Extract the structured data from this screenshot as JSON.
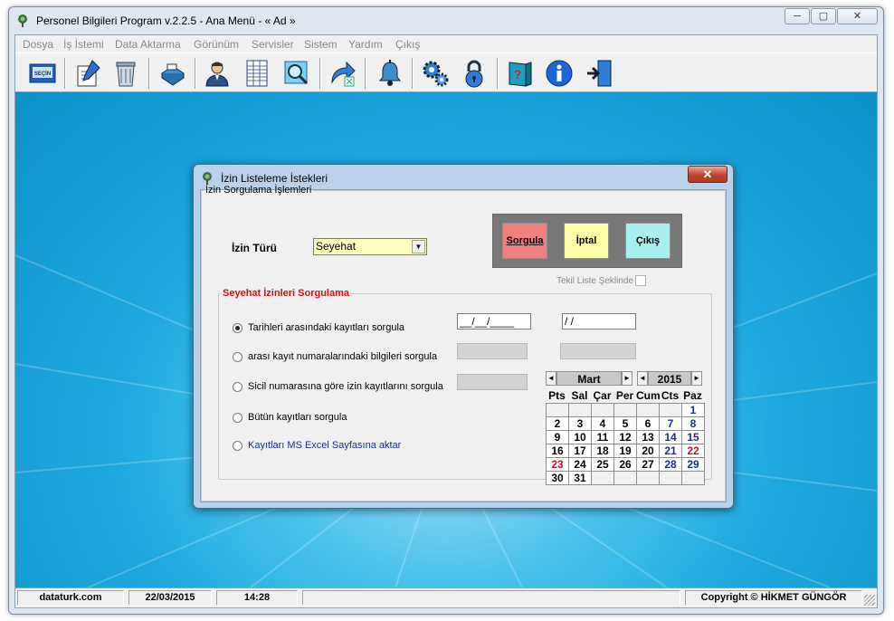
{
  "window": {
    "title": "Personel Bilgileri Program v.2.2.5  - Ana Menü -  « Ad »",
    "caption_min": "─",
    "caption_max": "▢",
    "caption_close": "✕"
  },
  "menu": [
    {
      "label": "Dosya"
    },
    {
      "label": "İş İstemi"
    },
    {
      "label": "Data Aktarma"
    },
    {
      "label": "Görünüm"
    },
    {
      "label": "Servisler"
    },
    {
      "label": "Sistem"
    },
    {
      "label": "Yardım"
    },
    {
      "label": "Çıkış"
    }
  ],
  "toolbar": {
    "icons": [
      "select-book-icon",
      "edit-form-icon",
      "recycle-bin-icon",
      "printer-icon",
      "users-icon",
      "spreadsheet-icon",
      "search-icon",
      "export-arrow-icon",
      "bell-icon",
      "gears-icon",
      "padlock-icon",
      "help-book-icon",
      "info-icon",
      "exit-door-icon"
    ],
    "select_book_label": "SEÇİN"
  },
  "dialog": {
    "title": "İzin Listeleme İstekleri",
    "close_label": "✕",
    "group_label": "İzin Sorgulama İşlemleri",
    "izin_turu_label": "İzin Türü",
    "izin_turu_value": "Seyehat",
    "buttons": {
      "sorgula": "Sorgula",
      "iptal": "İptal",
      "cikis": "Çıkış"
    },
    "tekil_label": "Tekil Liste Şeklinde",
    "sub_group_label": "Seyehat İzinleri Sorgulama",
    "options": [
      {
        "label": "Tarihleri arasındaki kayıtları sorgula",
        "selected": true
      },
      {
        "label": "arası kayıt numaralarındaki bilgileri sorgula",
        "selected": false
      },
      {
        "label": "Sicil numarasına göre izin kayıtlarını sorgula",
        "selected": false
      },
      {
        "label": "Bütün  kayıtları sorgula",
        "selected": false
      },
      {
        "label": "Kayıtları MS Excel Sayfasına aktar",
        "selected": false
      }
    ],
    "date_from": "__/__/____",
    "date_to": " / /"
  },
  "calendar": {
    "month": "Mart",
    "year": "2015",
    "prev": "◄",
    "next": "►",
    "day_names": [
      "Pts",
      "Sal",
      "Çar",
      "Per",
      "Cum",
      "Cts",
      "Paz"
    ],
    "weeks": [
      [
        "",
        "",
        "",
        "",
        "",
        "",
        "1"
      ],
      [
        "2",
        "3",
        "4",
        "5",
        "6",
        "7",
        "8"
      ],
      [
        "9",
        "10",
        "11",
        "12",
        "13",
        "14",
        "15"
      ],
      [
        "16",
        "17",
        "18",
        "19",
        "20",
        "21",
        "22"
      ],
      [
        "23",
        "24",
        "25",
        "26",
        "27",
        "28",
        "29"
      ],
      [
        "30",
        "31",
        "",
        "",
        "",
        "",
        ""
      ]
    ],
    "highlight_red": [
      "22",
      "23"
    ],
    "weekend_color": "#1a2f8a",
    "red_color": "#c8102e"
  },
  "status": {
    "site": "dataturk.com",
    "date": "22/03/2015",
    "time": "14:28",
    "copyright": "Copyright © HİKMET GÜNGÖR"
  },
  "colors": {
    "sorgula_bg": "#f08080",
    "iptal_bg": "#ffffa8",
    "cikis_bg": "#a8f0f0",
    "desktop": "#1ea8df",
    "legend_red": "#d0101a"
  }
}
